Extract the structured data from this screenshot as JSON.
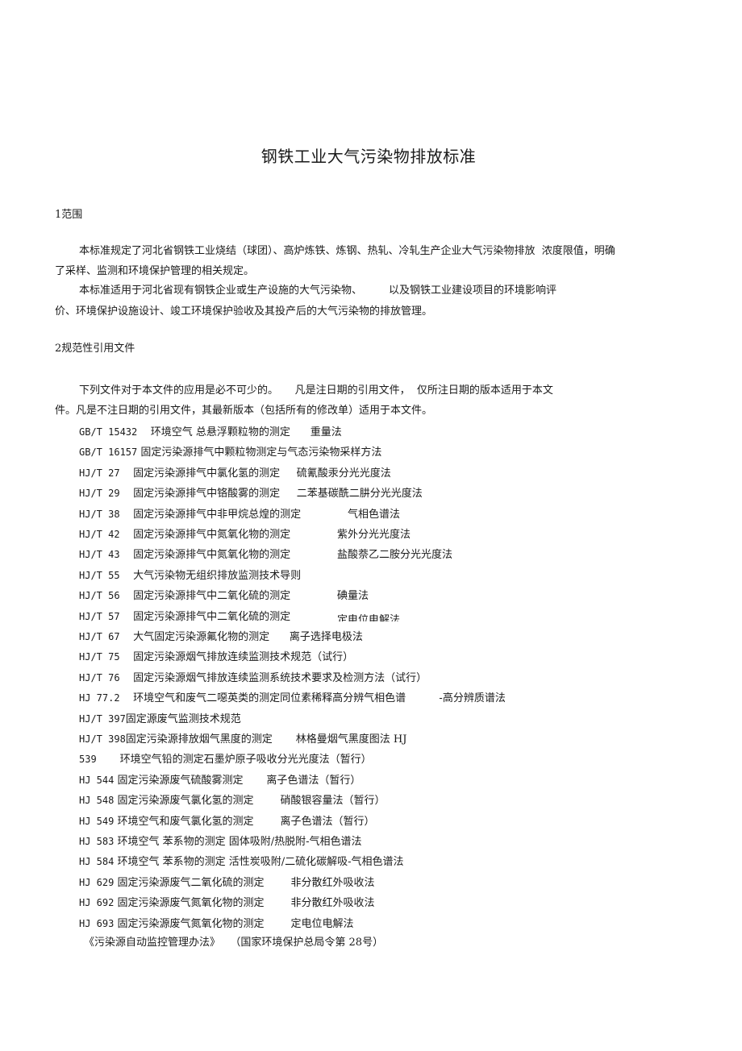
{
  "document": {
    "title": "钢铁工业大气污染物排放标准",
    "section1": {
      "heading": "1范围",
      "para1_line1": "本标准规定了河北省钢铁工业烧结（球团）、高炉炼铁、炼钢、热轧、冷轧生产企业大气污染物排放  浓度限值，明确",
      "para1_line2": "了采样、监测和环境保护管理的相关规定。",
      "para2_line1": "本标准适用于河北省现有钢铁企业或生产设施的大气污染物、        以及钢铁工业建设项目的环境影响评",
      "para2_line2": "价、环境保护设施设计、竣工环境保护验收及其投产后的大气污染物的排放管理。"
    },
    "section2": {
      "heading": "2规范性引用文件",
      "para_line1": "下列文件对于本文件的应用是必不可少的。     凡是注日期的引用文件，  仅所注日期的版本适用于本文",
      "para_line2": "件。凡是不注日期的引用文件，其最新版本（包括所有的修改单）适用于本文件。",
      "references": [
        {
          "code": "GB/T 15432",
          "title": "    环境空气 总悬浮颗粒物的测定      重量法"
        },
        {
          "code": "GB/T 16157",
          "title": " 固定污染源排气中颗粒物测定与气态污染物采样方法"
        },
        {
          "code": "HJ/T 27",
          "title": "    固定污染源排气中氯化氢的测定     硫氰酸汞分光光度法"
        },
        {
          "code": "HJ/T 29",
          "title": "    固定污染源排气中铬酸雾的测定     二苯基碳酰二肼分光光度法"
        },
        {
          "code": "HJ/T 38",
          "title": "    固定污染源排气中非甲烷总煌的测定              气相色谱法"
        },
        {
          "code": "HJ/T 42",
          "title": "    固定污染源排气中氮氧化物的测定              紫外分光光度法"
        },
        {
          "code": "HJ/T 43",
          "title": "    固定污染源排气中氮氧化物的测定              盐酸萘乙二胺分光光度法"
        },
        {
          "code": "HJ/T 55",
          "title": "    大气污染物无组织排放监测技术导则"
        },
        {
          "code": "HJ/T 56",
          "title": "    固定污染源排气中二氧化硫的测定              碘量法"
        },
        {
          "code": "HJ/T 57",
          "title": "    固定污染源排气中二氧化硫的测定              ",
          "clipped": "定电位电解法"
        },
        {
          "code": "HJ/T 67",
          "title": "    大气固定污染源氟化物的测定      离子选择电极法"
        },
        {
          "code": "HJ/T 75",
          "title": "    固定污染源烟气排放连续监测技术规范（试行）"
        },
        {
          "code": "HJ/T 76",
          "title": "    固定污染源烟气排放连续监测系统技术要求及检测方法（试行）"
        },
        {
          "code": "HJ 77.2",
          "title": "    环境空气和废气二噁英类的测定同位素稀释高分辨气相色谱          -高分辨质谱法"
        },
        {
          "code": "HJ/T 397",
          "title": "固定源废气监测技术规范"
        },
        {
          "code": "HJ/T 398",
          "title": "固定污染源排放烟气黑度的测定       林格曼烟气黑度图法 HJ"
        },
        {
          "code": "539",
          "title": "       环境空气铅的测定石墨炉原子吸收分光光度法（暂行）"
        },
        {
          "code": "HJ 544",
          "title": " 固定污染源废气硫酸雾测定       离子色谱法（暂行）"
        },
        {
          "code": "HJ 548",
          "title": " 固定污染源废气氯化氢的测定        硝酸银容量法（暂行）"
        },
        {
          "code": "HJ 549",
          "title": " 环境空气和废气氯化氢的测定        离子色谱法（暂行）"
        },
        {
          "code": "HJ 583",
          "title": " 环境空气 苯系物的测定 固体吸附/热脱附-气相色谱法"
        },
        {
          "code": "HJ 584",
          "title": " 环境空气 苯系物的测定 活性炭吸附/二硫化碳解吸-气相色谱法"
        },
        {
          "code": "HJ 629",
          "title": " 固定污染源废气二氧化硫的测定        非分散红外吸收法"
        },
        {
          "code": "HJ 692",
          "title": " 固定污染源废气氮氧化物的测定        非分散红外吸收法"
        },
        {
          "code": "HJ 693",
          "title": " 固定污染源废气氮氧化物的测定        定电位电解法"
        }
      ],
      "last_ref": "《污染源自动监控管理办法》   （国家环境保护总局令第 28号）"
    }
  }
}
